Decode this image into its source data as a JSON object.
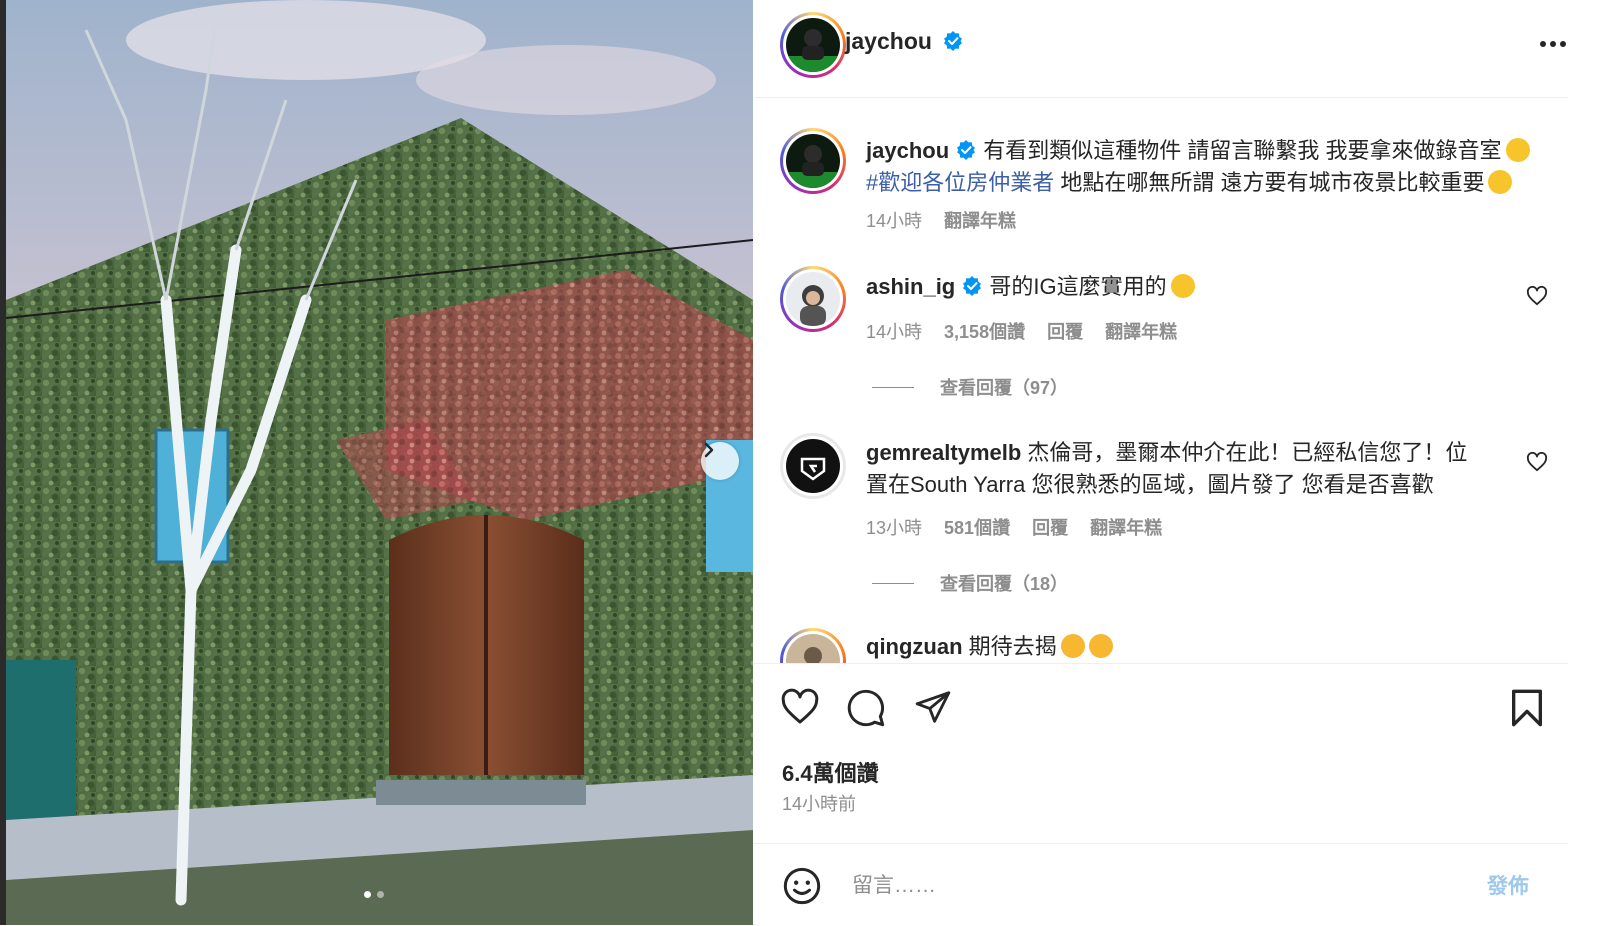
{
  "post": {
    "photo_alt": "",
    "carousel": {
      "count": 2,
      "active": 1
    }
  },
  "header": {
    "username": "jaychou",
    "verified": true
  },
  "caption": {
    "username": "jaychou",
    "text_line1": "有看到類似這種物件 請留言聯繫我 我要拿來做錄音室",
    "hashtag": "#歡迎各位房仲業者",
    "text_line2": " 地點在哪無所謂 遠方要有城市夜景比較重要",
    "time": "14小時",
    "translate": "翻譯年糕"
  },
  "comments": [
    {
      "username": "ashin_ig",
      "verified": true,
      "text": "哥的IG這麼實用的",
      "time": "14小時",
      "likes": "3,158個讚",
      "reply": "回覆",
      "translate": "翻譯年糕",
      "view_replies": "查看回覆（97）"
    },
    {
      "username": "gemrealtymelb",
      "verified": false,
      "text_line1": "杰倫哥，墨爾本仲介在此！已經私信您了！位",
      "text_line2": "置在South Yarra 您很熟悉的區域，圖片發了 您看是否喜歡",
      "time": "13小時",
      "likes": "581個讚",
      "reply": "回覆",
      "translate": "翻譯年糕",
      "view_replies": "查看回覆（18）"
    },
    {
      "username": "qingzuan",
      "text": "期待去揭"
    }
  ],
  "actions": {
    "likes": "6.4萬個讚",
    "time": "14小時前"
  },
  "composer": {
    "placeholder": "留言……",
    "post_label": "發佈"
  },
  "colors": {
    "verified": "#0095f6",
    "link": "#3b5ea8",
    "muted": "#8e8e8e"
  }
}
